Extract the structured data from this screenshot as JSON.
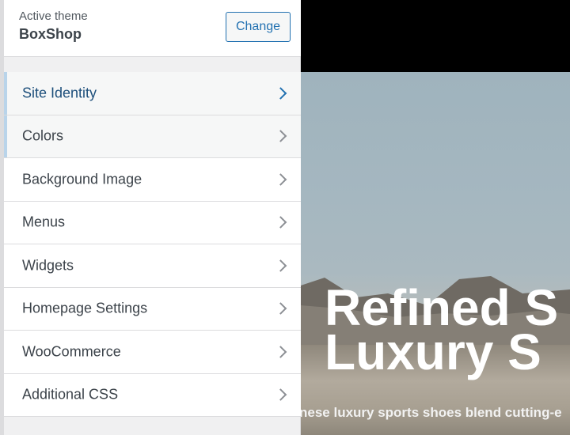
{
  "theme": {
    "active_label": "Active theme",
    "name": "BoxShop",
    "change_label": "Change"
  },
  "menu": {
    "items": [
      {
        "label": "Site Identity"
      },
      {
        "label": "Colors"
      },
      {
        "label": "Background Image"
      },
      {
        "label": "Menus"
      },
      {
        "label": "Widgets"
      },
      {
        "label": "Homepage Settings"
      },
      {
        "label": "WooCommerce"
      },
      {
        "label": "Additional CSS"
      }
    ]
  },
  "preview": {
    "hero_title_line1": "Refined S",
    "hero_title_line2": "Luxury S",
    "hero_text": "nese luxury sports shoes blend cutting-e"
  },
  "colors": {
    "accent": "#2271b1",
    "accent_bar": "#b9d4ea"
  },
  "icons": {
    "chevron": "chevron-right-icon"
  }
}
